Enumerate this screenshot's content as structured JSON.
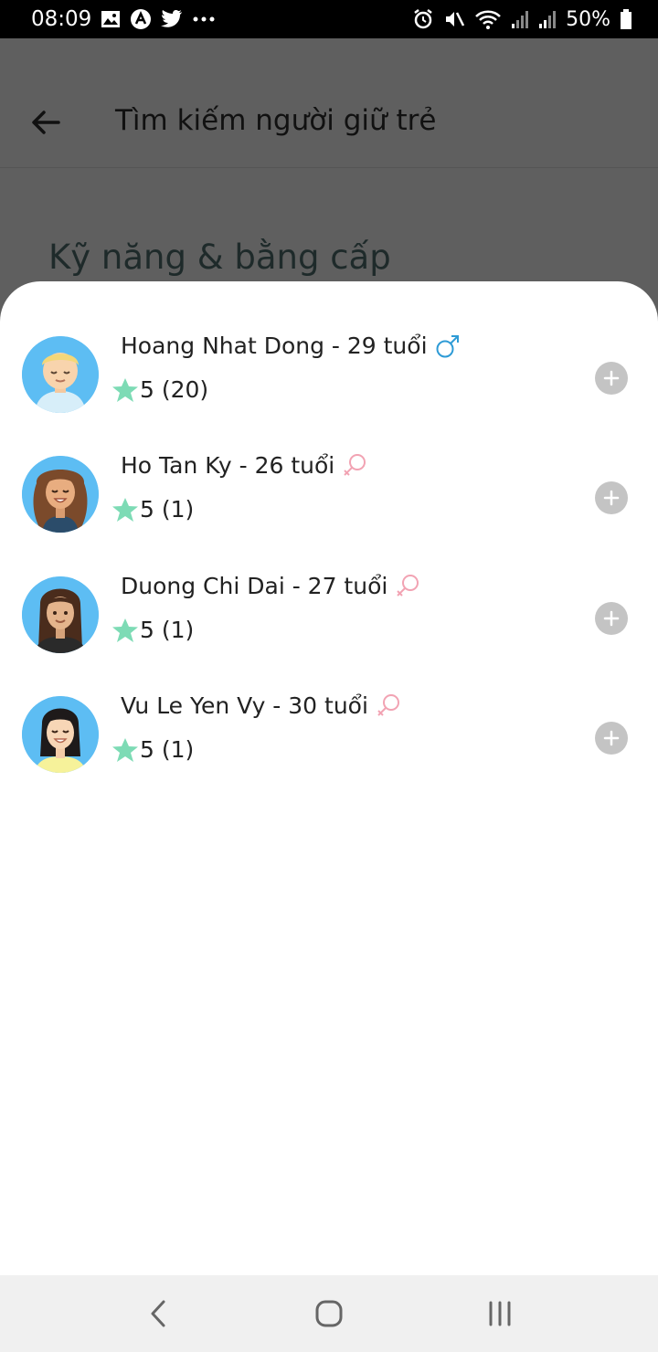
{
  "status_bar": {
    "time": "08:09",
    "battery": "50%",
    "icons": [
      "image-icon",
      "app-a-icon",
      "twitter-icon",
      "more-dots-icon",
      "alarm-icon",
      "mute-icon",
      "wifi-icon",
      "signal-icon",
      "signal-icon",
      "battery-icon"
    ]
  },
  "header": {
    "title": "Tìm kiếm người giữ trẻ",
    "back_icon": "arrow-left-icon"
  },
  "background_section": {
    "heading": "Kỹ năng & bằng cấp"
  },
  "sitters": [
    {
      "name": "Hoang Nhat Dong - 29 tuổi",
      "gender": "male",
      "rating": "5 (20)"
    },
    {
      "name": "Ho Tan Ky - 26 tuổi",
      "gender": "female",
      "rating": "5 (1)"
    },
    {
      "name": "Duong Chi Dai - 27 tuổi",
      "gender": "female",
      "rating": "5 (1)"
    },
    {
      "name": "Vu Le Yen Vy - 30 tuổi",
      "gender": "female",
      "rating": "5 (1)"
    }
  ],
  "colors": {
    "star": "#7ddbb5",
    "male": "#2e9bd6",
    "female": "#f2a3b3",
    "add_button": "#c4c4c4",
    "avatar_bg": "#5dbdf3",
    "scrim": "#5f5f5f"
  },
  "nav_bar": {
    "buttons": [
      "back-nav-icon",
      "home-nav-icon",
      "recents-nav-icon"
    ]
  }
}
